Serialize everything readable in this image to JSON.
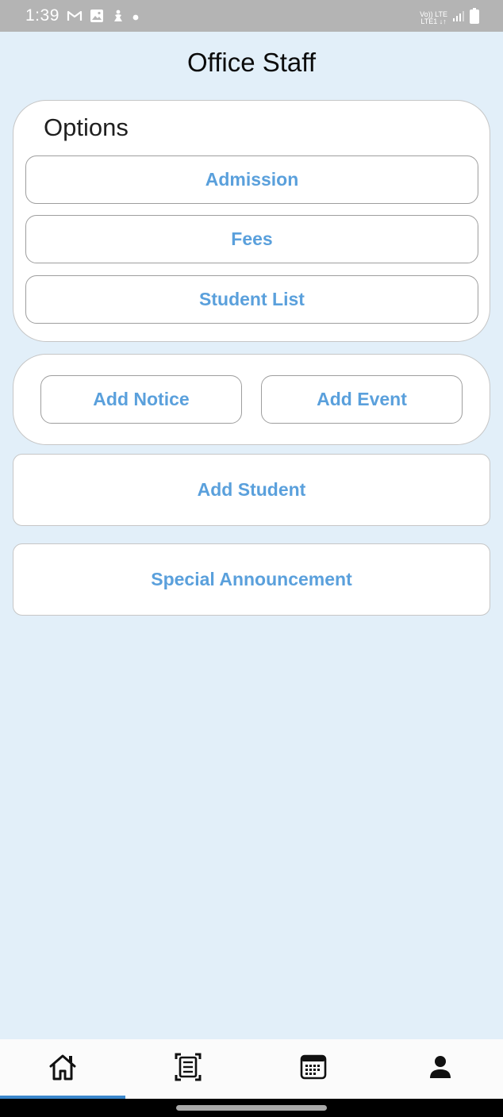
{
  "status_bar": {
    "time": "1:39",
    "network_top": "Vo)) LTE",
    "network_bottom": "LTE1 ↓↑"
  },
  "header": {
    "title": "Office Staff"
  },
  "options": {
    "heading": "Options",
    "buttons": [
      {
        "label": "Admission"
      },
      {
        "label": "Fees"
      },
      {
        "label": "Student List"
      }
    ]
  },
  "actions": {
    "add_notice": "Add Notice",
    "add_event": "Add Event"
  },
  "add_student": "Add Student",
  "special_announcement": "Special Announcement",
  "bottom_nav": {
    "items": [
      {
        "icon": "home-icon",
        "selected": true
      },
      {
        "icon": "notice-board-icon",
        "selected": false
      },
      {
        "icon": "calendar-icon",
        "selected": false
      },
      {
        "icon": "profile-icon",
        "selected": false
      }
    ]
  },
  "colors": {
    "background": "#e2eff9",
    "accent_text": "#5aa0dc",
    "nav_indicator": "#3a87cc",
    "status_bar": "#b4b4b4"
  }
}
